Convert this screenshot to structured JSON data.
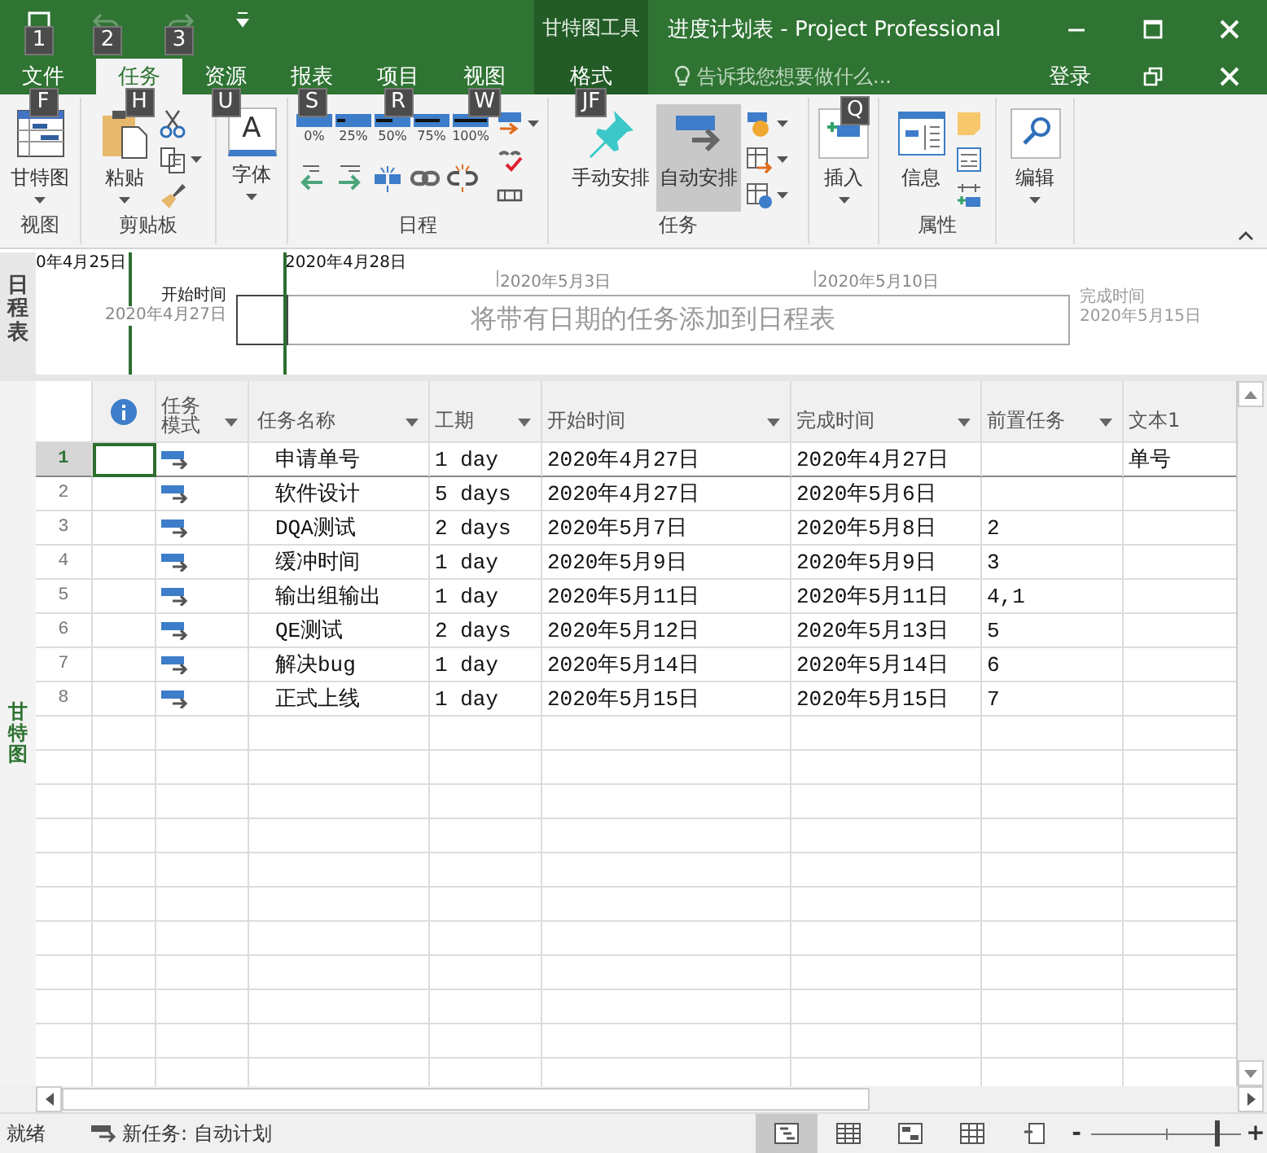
{
  "window": {
    "title": "进度计划表 - Project Professional",
    "context_group": "甘特图工具"
  },
  "quick_access": [
    {
      "keytip": "1",
      "disabled": false
    },
    {
      "keytip": "2",
      "disabled": true
    },
    {
      "keytip": "3",
      "disabled": true
    },
    {
      "disabled": false
    }
  ],
  "tabs": [
    {
      "label": "文件",
      "keytip": "F",
      "selected": false
    },
    {
      "label": "任务",
      "keytip": "H",
      "selected": true
    },
    {
      "label": "资源",
      "keytip": "U",
      "selected": false
    },
    {
      "label": "报表",
      "keytip": "S",
      "selected": false
    },
    {
      "label": "项目",
      "keytip": "R",
      "selected": false
    },
    {
      "label": "视图",
      "keytip": "W",
      "selected": false
    }
  ],
  "context_tab": {
    "label": "格式",
    "keytip": "JF",
    "selected": false
  },
  "tell_me": {
    "placeholder": "告诉我您想要做什么...",
    "keytip": "Q"
  },
  "sign_in": "登录",
  "ribbon_groups": [
    {
      "label": "视图",
      "controls": [
        {
          "kind": "large",
          "label": "甘特图",
          "dropdown": true,
          "selected": false
        }
      ]
    },
    {
      "label": "剪贴板",
      "controls": [
        {
          "kind": "large",
          "label": "粘贴",
          "dropdown": true,
          "selected": false
        },
        {
          "kind": "stack",
          "items": [
            {
              "dropdown": false
            },
            {
              "dropdown": true
            },
            {
              "dropdown": false
            }
          ]
        }
      ]
    },
    {
      "controls": [
        {
          "kind": "large",
          "icon_text": "A",
          "label": "字体",
          "dropdown": true,
          "selected": false
        }
      ]
    },
    {
      "label": "日程",
      "controls": [
        {
          "kind": "schedule",
          "percents": [
            "0%",
            "25%",
            "50%",
            "75%",
            "100%"
          ]
        },
        {
          "kind": "stack",
          "items": [
            {
              "dropdown": true
            },
            {
              "dropdown": false
            },
            {
              "dropdown": false
            }
          ]
        }
      ]
    },
    {
      "label": "任务",
      "controls": [
        {
          "kind": "large",
          "label": "手动安排",
          "dropdown": false,
          "selected": false
        },
        {
          "kind": "large",
          "label": "自动安排",
          "dropdown": false,
          "selected": true
        },
        {
          "kind": "stack",
          "items": [
            {
              "dropdown": true
            },
            {
              "dropdown": true
            },
            {
              "dropdown": true
            }
          ]
        }
      ]
    },
    {
      "controls": [
        {
          "kind": "large",
          "label": "插入",
          "dropdown": true,
          "selected": false
        }
      ]
    },
    {
      "label": "属性",
      "controls": [
        {
          "kind": "large",
          "label": "信息",
          "dropdown": false,
          "selected": false
        },
        {
          "kind": "stack",
          "items": [
            {
              "dropdown": false
            },
            {
              "dropdown": false
            },
            {
              "dropdown": false
            }
          ]
        }
      ]
    },
    {
      "controls": [
        {
          "kind": "large",
          "label": "编辑",
          "dropdown": true,
          "selected": false
        }
      ]
    }
  ],
  "timeline": {
    "side_label": "日程表",
    "date_marks": [
      {
        "label": "0年4月25日",
        "kind": "major"
      },
      {
        "label": "2020年4月28日",
        "kind": "major"
      },
      {
        "label": "2020年5月3日",
        "kind": "minor"
      },
      {
        "label": "2020年5月10日",
        "kind": "minor"
      }
    ],
    "start": {
      "label": "开始时间",
      "date": "2020年4月27日"
    },
    "finish": {
      "label": "完成时间",
      "date": "2020年5月15日"
    },
    "placeholder": "将带有日期的任务添加到日程表"
  },
  "view_label": "甘特图",
  "table": {
    "columns": [
      {
        "kind": "indicators",
        "filter": false
      },
      {
        "kind": "text",
        "label": "任务模式",
        "filter": true
      },
      {
        "kind": "text",
        "label": "任务名称",
        "filter": true
      },
      {
        "kind": "text",
        "label": "工期",
        "filter": true
      },
      {
        "kind": "text",
        "label": "开始时间",
        "filter": true
      },
      {
        "kind": "text",
        "label": "完成时间",
        "filter": true
      },
      {
        "kind": "text",
        "label": "前置任务",
        "filter": true
      },
      {
        "kind": "text",
        "label": "文本1",
        "filter": false
      }
    ],
    "rows": [
      {
        "id": "1",
        "selected": true,
        "name": "申请单号",
        "duration": "1 day",
        "start": "2020年4月27日",
        "finish": "2020年4月27日",
        "text1": "单号"
      },
      {
        "id": "2",
        "selected": false,
        "name": "软件设计",
        "duration": "5 days",
        "start": "2020年4月27日",
        "finish": "2020年5月6日"
      },
      {
        "id": "3",
        "selected": false,
        "name": "DQA测试",
        "duration": "2 days",
        "start": "2020年5月7日",
        "finish": "2020年5月8日",
        "predecessors": "2"
      },
      {
        "id": "4",
        "selected": false,
        "name": "缓冲时间",
        "duration": "1 day",
        "start": "2020年5月9日",
        "finish": "2020年5月9日",
        "predecessors": "3"
      },
      {
        "id": "5",
        "selected": false,
        "name": "输出组输出",
        "duration": "1 day",
        "start": "2020年5月11日",
        "finish": "2020年5月11日",
        "predecessors": "4,1"
      },
      {
        "id": "6",
        "selected": false,
        "name": "QE测试",
        "duration": "2 days",
        "start": "2020年5月12日",
        "finish": "2020年5月13日",
        "predecessors": "5"
      },
      {
        "id": "7",
        "selected": false,
        "name": "解决bug",
        "duration": "1 day",
        "start": "2020年5月14日",
        "finish": "2020年5月14日",
        "predecessors": "6"
      },
      {
        "id": "8",
        "selected": false,
        "name": "正式上线",
        "duration": "1 day",
        "start": "2020年5月15日",
        "finish": "2020年5月15日",
        "predecessors": "7"
      }
    ]
  },
  "status_bar": {
    "status": "就绪",
    "new_task": "新任务: 自动计划",
    "views": [
      {
        "selected": true
      },
      {
        "selected": false
      },
      {
        "selected": false
      },
      {
        "selected": false
      },
      {
        "selected": false
      }
    ],
    "zoom": {
      "out": "-",
      "in": "+",
      "level": 0.85
    }
  }
}
